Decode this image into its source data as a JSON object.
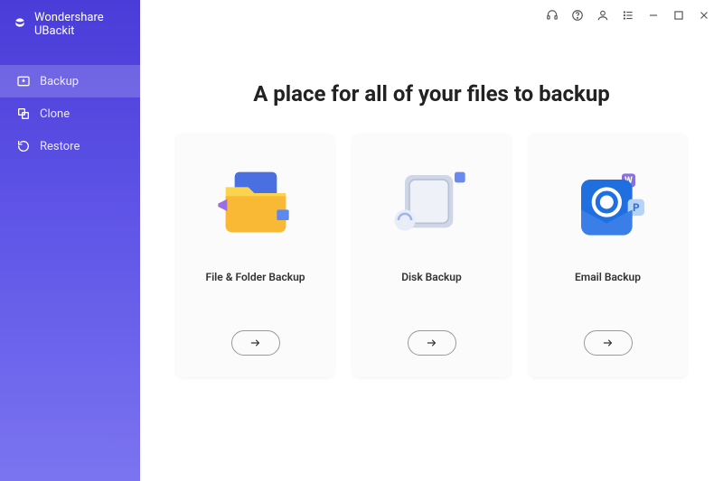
{
  "brand": {
    "name": "Wondershare UBackit"
  },
  "sidebar": {
    "items": [
      {
        "label": "Backup",
        "icon": "backup-icon",
        "active": true
      },
      {
        "label": "Clone",
        "icon": "clone-icon",
        "active": false
      },
      {
        "label": "Restore",
        "icon": "restore-icon",
        "active": false
      }
    ]
  },
  "titlebar": {
    "icons": [
      "headset-icon",
      "help-icon",
      "user-icon",
      "menu-icon",
      "minimize-icon",
      "maximize-icon",
      "close-icon"
    ]
  },
  "main": {
    "headline": "A place for all of your files to backup",
    "cards": [
      {
        "title": "File & Folder Backup",
        "illus": "folder"
      },
      {
        "title": "Disk Backup",
        "illus": "disk"
      },
      {
        "title": "Email Backup",
        "illus": "email"
      }
    ]
  }
}
